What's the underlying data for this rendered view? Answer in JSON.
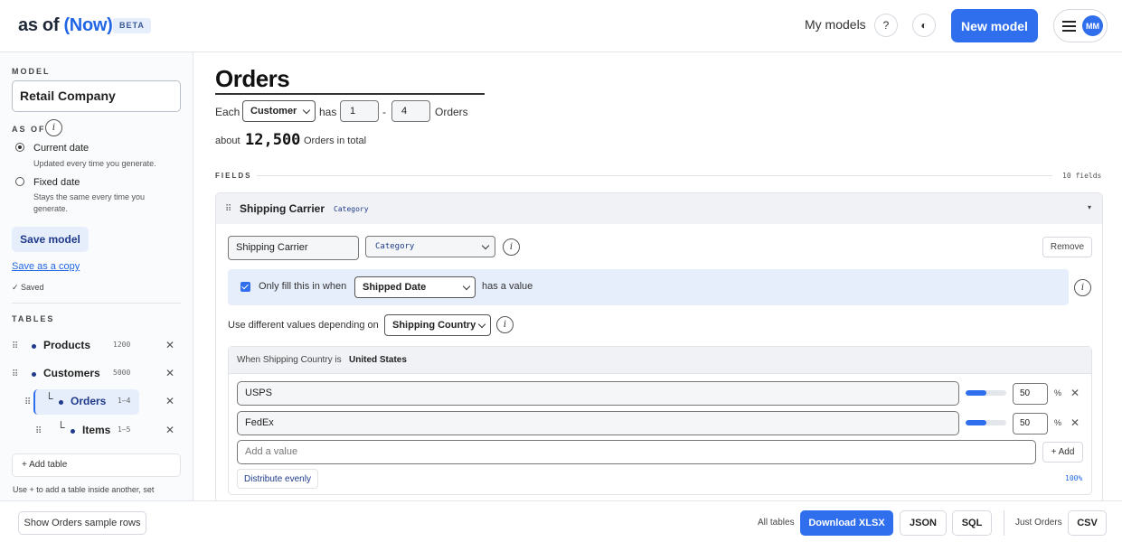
{
  "header": {
    "logo_prefix": "as of ",
    "logo_accent": "(Now)",
    "beta": "BETA",
    "my_models": "My models",
    "help": "?",
    "theme": "◐",
    "new_model": "New model",
    "avatar": "MM"
  },
  "sidebar": {
    "model_label": "MODEL",
    "model_name": "Retail Company",
    "as_of_label": "AS OF",
    "info": "i",
    "current_date": {
      "title": "Current date",
      "sub": "Updated every time you generate.",
      "selected": true
    },
    "fixed_date": {
      "title": "Fixed date",
      "sub": "Stays the same every time you generate.",
      "selected": false
    },
    "save_model": "Save model",
    "save_copy": "Save as a copy",
    "saved": "✓  Saved",
    "tables_label": "TABLES",
    "tables": [
      {
        "name": "Products",
        "count": "1200"
      },
      {
        "name": "Customers",
        "count": "5000"
      },
      {
        "name": "Orders",
        "count": "1–4"
      },
      {
        "name": "Items",
        "count": "1–5"
      }
    ],
    "remove": "✕",
    "elbow": "└",
    "add_table": "+ Add table",
    "hint": "Use + to add a table inside another, set"
  },
  "main": {
    "title": "Orders",
    "each": "Each",
    "parent": "Customer",
    "has": "has",
    "min": "1",
    "dash": "-",
    "max": "4",
    "child": "Orders",
    "about": "about",
    "total": "12,500",
    "total_suffix": "Orders in total",
    "fields_label": "FIELDS",
    "fields_count": "10 fields",
    "field": {
      "name": "Shipping Carrier",
      "type": "Category",
      "caret": "▾",
      "remove": "Remove",
      "only_fill": "Only fill this in when",
      "condition_field": "Shipped Date",
      "has_value": "has a value",
      "depend_text": "Use different values depending on",
      "depend_field": "Shipping Country",
      "when_label": "When Shipping Country is",
      "when_value": "United States",
      "values": [
        {
          "label": "USPS",
          "percent": "50",
          "share": 0.5
        },
        {
          "label": "FedEx",
          "percent": "50",
          "share": 0.5
        }
      ],
      "pct_sign": "%",
      "add_placeholder": "Add a value",
      "add_button": "+ Add",
      "distribute": "Distribute evenly",
      "total_pct": "100%"
    }
  },
  "footer": {
    "sample": "Show Orders sample rows",
    "all_tables": "All tables",
    "download_xlsx": "Download XLSX",
    "json": "JSON",
    "sql": "SQL",
    "just_orders": "Just Orders",
    "csv": "CSV"
  },
  "colors": {
    "accent": "#2f6fed",
    "navy": "#1f3a8a",
    "highlight": "#e6eefc"
  }
}
